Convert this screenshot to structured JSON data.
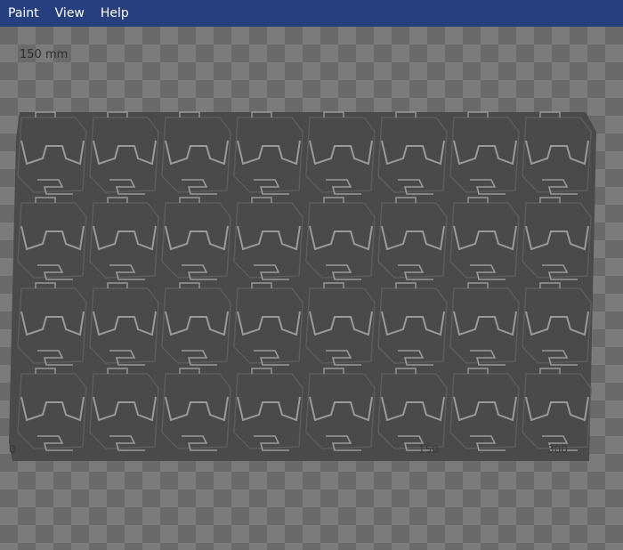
{
  "menu": {
    "items": [
      "Paint",
      "View",
      "Help"
    ]
  },
  "canvas": {
    "scale_label": "150 mm",
    "axis_labels": {
      "left": "0",
      "middle": "150",
      "right": "300"
    },
    "checker_colors": {
      "dark": "#6a6a6a",
      "light": "#7b7b7b"
    },
    "tile_color": "#4a4a4a",
    "highlight_color": "#9a9a9a",
    "grid": {
      "columns": 8,
      "rows": 4
    }
  }
}
